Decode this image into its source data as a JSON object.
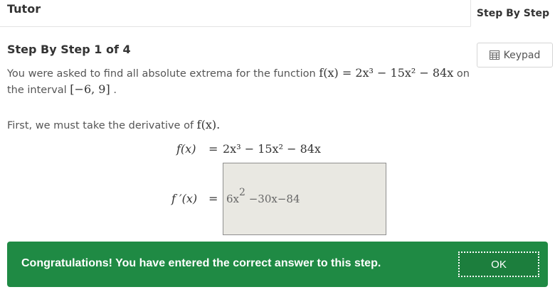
{
  "header": {
    "title": "Tutor",
    "tab_label": "Step By Step"
  },
  "step": {
    "title": "Step By Step 1 of 4",
    "intro_prefix": "You were asked to find all absolute extrema for the function",
    "intro_function": "f(x) = 2x³ − 15x² − 84x",
    "intro_on": "on",
    "intro_interval_prefix": "the interval",
    "intro_interval": "[−6, 9]",
    "intro_period": ".",
    "first_text": "First, we must take the derivative of",
    "first_function": "f(x).",
    "equation1_lhs": "f(x)",
    "equation1_eq": "=",
    "equation1_rhs": "2x³ − 15x² − 84x",
    "equation2_lhs": "f ′(x)",
    "equation2_eq": "=",
    "answer_coef": "6x",
    "answer_exp": "2",
    "answer_rest": "−30x−84"
  },
  "keypad": {
    "label": "Keypad",
    "icon": "keypad-icon"
  },
  "banner": {
    "message": "Congratulations! You have entered the correct answer to this step.",
    "ok_label": "OK",
    "color": "#1f8a44"
  }
}
